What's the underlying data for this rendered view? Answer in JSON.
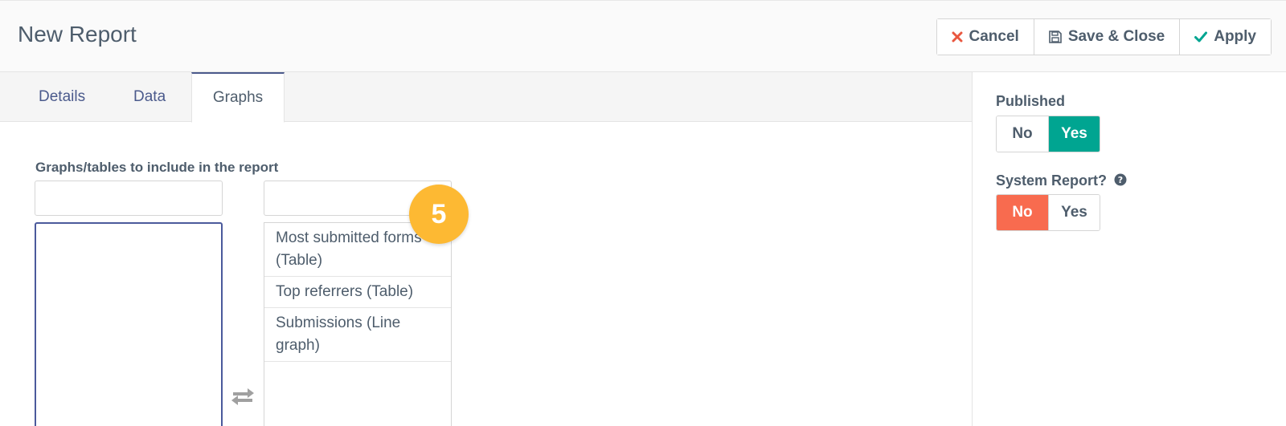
{
  "header": {
    "title": "New Report",
    "buttons": {
      "cancel": "Cancel",
      "save_close": "Save & Close",
      "apply": "Apply"
    },
    "icons": {
      "cancel": "close-icon",
      "save_close": "save-icon",
      "apply": "check-icon"
    }
  },
  "tabs": [
    {
      "label": "Details",
      "active": false
    },
    {
      "label": "Data",
      "active": false
    },
    {
      "label": "Graphs",
      "active": true
    }
  ],
  "graphs": {
    "label": "Graphs/tables to include in the report",
    "available_filter_placeholder": "",
    "selected_filter_placeholder": "",
    "selected_items": [],
    "available_items": [
      "Most submitted forms (Table)",
      "Top referrers (Table)",
      "Submissions (Line graph)"
    ],
    "step_badge": "5",
    "swap_icon": "swap-arrows-icon"
  },
  "sidebar": {
    "published": {
      "label": "Published",
      "no": "No",
      "yes": "Yes",
      "selected": "Yes"
    },
    "system_report": {
      "label": "System Report?",
      "no": "No",
      "yes": "Yes",
      "selected": "No",
      "help_icon": "question-circle-icon"
    }
  },
  "colors": {
    "accent": "#4b5a8c",
    "toggle_yes_active": "#00a591",
    "toggle_no_active": "#f86b4f",
    "badge": "#fdb933",
    "cancel_icon": "#e9573f",
    "apply_icon": "#00a591"
  }
}
